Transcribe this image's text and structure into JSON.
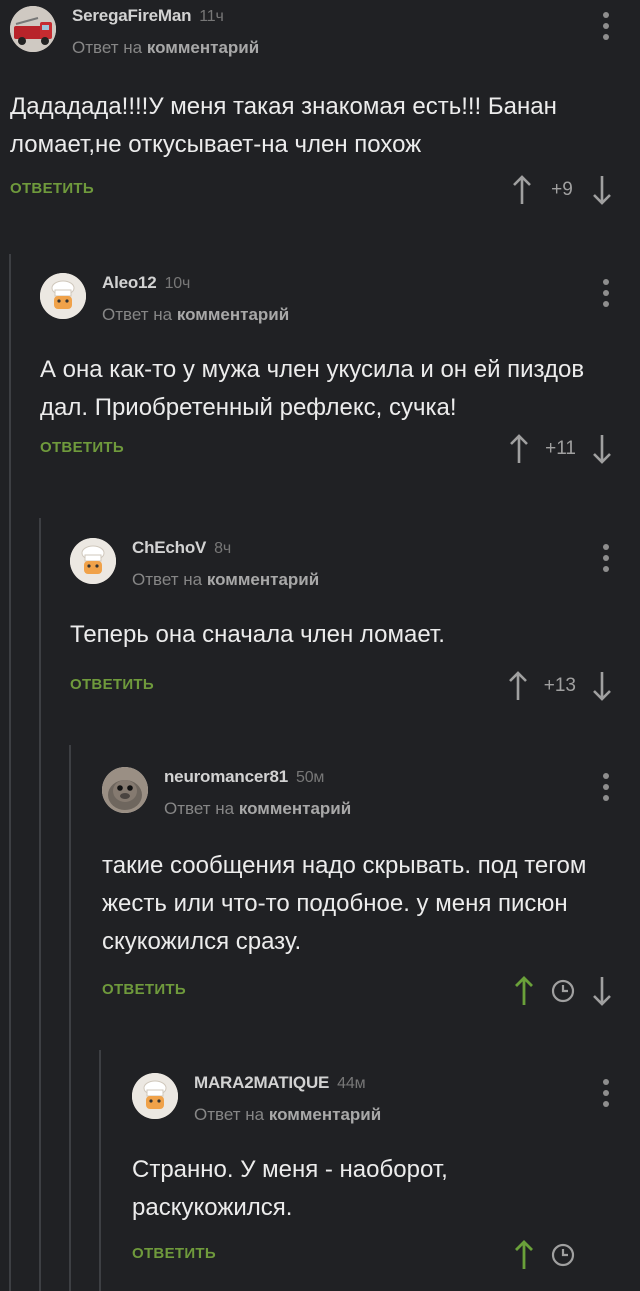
{
  "colors": {
    "background": "#202124",
    "reply_green": "#6f9a3c",
    "upvoted_green": "#6aa13a",
    "muted": "#8e8e8e"
  },
  "comments": [
    {
      "username": "SeregaFireMan",
      "time": "11ч",
      "reply_prefix": "Ответ на",
      "reply_target": "комментарий",
      "avatar_icon": "fire-truck-avatar",
      "text": "Дададада!!!!У меня такая знакомая есть!!! Банан ломает,не откусывает-на член похож",
      "reply_label": "ОТВЕТИТЬ",
      "score": "+9",
      "upvoted": false
    },
    {
      "username": "Aleo12",
      "time": "10ч",
      "reply_prefix": "Ответ на",
      "reply_target": "комментарий",
      "avatar_icon": "default-chef-avatar",
      "text": "А она как-то у мужа член укусила и он ей пиздов дал. Приобретенный рефлекс, сучка!",
      "reply_label": "ОТВЕТИТЬ",
      "score": "+11",
      "upvoted": false
    },
    {
      "username": "ChEchoV",
      "time": "8ч",
      "reply_prefix": "Ответ на",
      "reply_target": "комментарий",
      "avatar_icon": "default-chef-avatar",
      "text": "Теперь она сначала член ломает.",
      "reply_label": "ОТВЕТИТЬ",
      "score": "+13",
      "upvoted": false
    },
    {
      "username": "neuromancer81",
      "time": "50м",
      "reply_prefix": "Ответ на",
      "reply_target": "комментарий",
      "avatar_icon": "seal-photo-avatar",
      "text": "такие сообщения надо скрывать. под тегом жесть или что-то подобное. у меня писюн скукожился сразу.",
      "reply_label": "ОТВЕТИТЬ",
      "score_icon": "clock-icon",
      "upvoted": true
    },
    {
      "username": "MARA2MATIQUE",
      "time": "44м",
      "reply_prefix": "Ответ на",
      "reply_target": "комментарий",
      "avatar_icon": "default-chef-avatar",
      "text": "Странно. У меня - наоборот, раскукожился.",
      "reply_label": "ОТВЕТИТЬ",
      "score_icon": "clock-icon",
      "upvoted": true
    }
  ]
}
